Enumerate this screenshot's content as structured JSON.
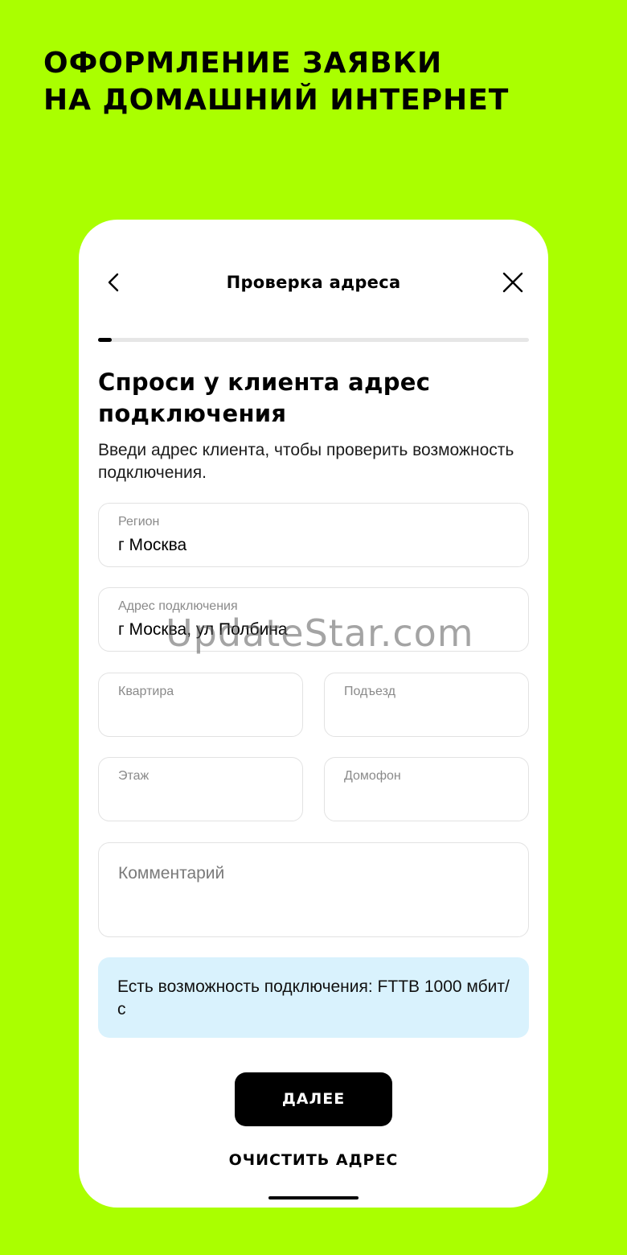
{
  "promo": {
    "title_line1": "ОФОРМЛЕНИЕ ЗАЯВКИ",
    "title_line2": "НА ДОМАШНИЙ ИНТЕРНЕТ"
  },
  "header": {
    "title": "Проверка адреса",
    "back_icon": "chevron-left-icon",
    "close_icon": "close-icon"
  },
  "progress": {
    "fraction": 0.032
  },
  "section": {
    "heading": "Спроси у клиента адрес подключения",
    "description": "Введи адрес клиента, чтобы проверить возможность подключения."
  },
  "form": {
    "region": {
      "label": "Регион",
      "value": "г Москва"
    },
    "address": {
      "label": "Адрес подключения",
      "value": "г Москва, ул Полбина"
    },
    "flat": {
      "label": "Квартира",
      "value": ""
    },
    "entrance": {
      "label": "Подъезд",
      "value": ""
    },
    "floor": {
      "label": "Этаж",
      "value": ""
    },
    "intercom": {
      "label": "Домофон",
      "value": ""
    },
    "comment": {
      "placeholder": "Комментарий",
      "value": ""
    }
  },
  "info": {
    "text": "Есть возможность подключения: FTTB 1000 мбит/с"
  },
  "actions": {
    "next_label": "ДАЛЕЕ",
    "clear_label": "ОЧИСТИТЬ АДРЕС"
  },
  "watermark": "UpdateStar.com",
  "colors": {
    "background": "#aaff00",
    "card": "#ffffff",
    "info_box": "#d9f2fd",
    "primary_button": "#000000"
  }
}
